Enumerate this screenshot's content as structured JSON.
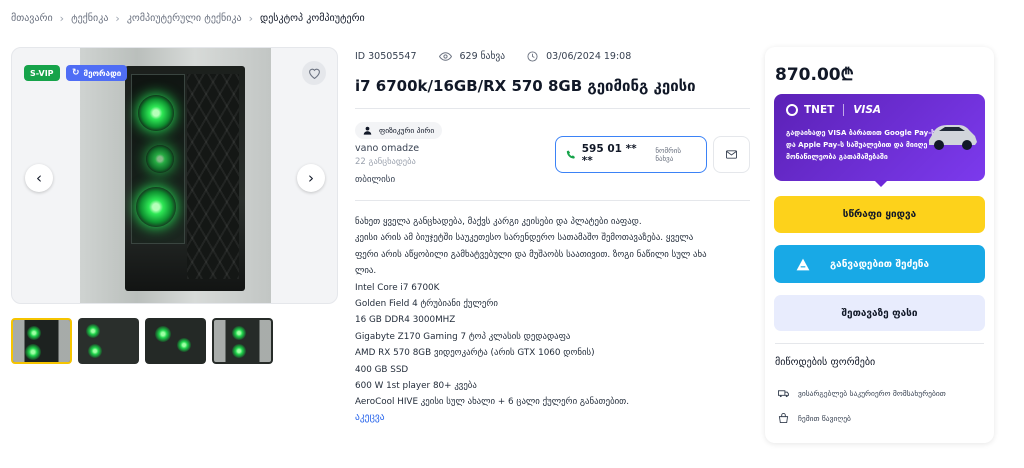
{
  "breadcrumb": {
    "items": [
      "მთავარი",
      "ტექნიკა",
      "კომპიუტერული ტექნიკა",
      "დესკტოპ კომპიუტერი"
    ]
  },
  "gallery": {
    "badges": {
      "svip": "S-VIP",
      "renew": "მეორადი"
    },
    "thumbnails_count": 4,
    "active_thumbnail": 1
  },
  "listing": {
    "id_text": "ID 30505547",
    "views_text": "629 ნახვა",
    "date_text": "03/06/2024 19:08",
    "title": "i7 6700k/16GB/RX 570 8GB გეიმინგ კეისი"
  },
  "seller": {
    "type_label": "ფიზიკური პირი",
    "name": "vano omadze",
    "ads_count": "22 განცხადება",
    "city": "თბილისი",
    "phone": "595 01 ** **",
    "phone_show": "ნომრის ნახვა"
  },
  "description": {
    "lines": [
      "ნახეთ ყველა განცხადება, მაქვს კარგი კეისები და პლატები იაფად.",
      "კეისი არის ამ ბიუჯეტში საუკეთესო სარენდერო სათამაშო შემოთავაზება. ყველა",
      "ფერი არის აწყობილი გამხატვებული და მუშაობს საათივით. ზოგი ნაწილი სულ ახა",
      "ლია.",
      "Intel Core i7 6700K",
      "Golden Field 4 ტრუბიანი ქულერი",
      "16 GB DDR4 3000MHZ",
      "Gigabyte Z170 Gaming 7 ტოპ კლასის დედადაფა",
      "AMD RX 570 8GB ვიდეოკარტა (არის GTX 1060 დონის)",
      "400 GB SSD",
      "600 W 1st player 80+ კვება",
      "AeroCool HIVE კეისი სულ ახალი + 6 ცალი ქულერი განათებით."
    ],
    "more_link": "აკეცვა"
  },
  "purchase": {
    "price": "870.00₾",
    "promo": {
      "brand_left": "TNET",
      "brand_right": "VISA",
      "text": "გადაიხადე VISA ბარათით Google Pay-ს და Apple Pay-ს საშუალებით და მიიღე მონაწილეობა გათამაშებაში"
    },
    "buy_now": "სწრაფი ყიდვა",
    "installment": "განვადებით შეძენა",
    "offer_price": "შეთავაზე ფასი",
    "delivery_title": "მიწოდების ფორმები",
    "delivery_options": [
      "ვისარგებლებ საკურიერო მომსახურებით",
      "ჩემით წავიღებ"
    ]
  },
  "colors": {
    "accent_blue": "#2563eb",
    "buy_yellow": "#fdd21b",
    "install_blue": "#18a9e6",
    "svip_green": "#16a34a",
    "promo_purple": "#6d28d9",
    "phone_green": "#16a34a"
  },
  "icons": {
    "breadcrumb_sep": "chevron-right-icon",
    "views": "eye-icon",
    "date": "clock-icon",
    "seller": "user-icon",
    "phone": "phone-icon",
    "mail": "mail-icon",
    "fav": "heart-icon",
    "install": "installment-icon",
    "delivery_courier": "truck-icon",
    "delivery_self": "pickup-icon"
  }
}
